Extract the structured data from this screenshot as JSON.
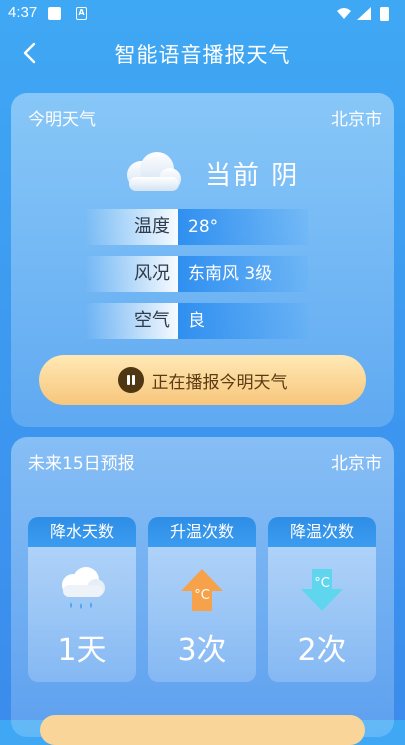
{
  "status_bar": {
    "time": "4:37",
    "notif_icon_letter": "A"
  },
  "header": {
    "title": "智能语音播报天气"
  },
  "today_card": {
    "title": "今明天气",
    "city": "北京市",
    "current": "当前 阴",
    "rows": [
      {
        "label": "温度",
        "value": "28°"
      },
      {
        "label": "风况",
        "value": "东南风 3级"
      },
      {
        "label": "空气",
        "value": "良"
      }
    ],
    "play_button": "正在播报今明天气"
  },
  "forecast_card": {
    "title": "未来15日预报",
    "city": "北京市",
    "stats": [
      {
        "label": "降水天数",
        "value": "1天",
        "icon": "rain-cloud-icon"
      },
      {
        "label": "升温次数",
        "value": "3次",
        "icon": "temp-up-arrow-icon",
        "icon_text": "°C"
      },
      {
        "label": "降温次数",
        "value": "2次",
        "icon": "temp-down-arrow-icon",
        "icon_text": "°C"
      }
    ]
  },
  "colors": {
    "play_button": "#f7c67c",
    "up_arrow": "#f5a24a",
    "down_arrow": "#5fd6ee"
  }
}
